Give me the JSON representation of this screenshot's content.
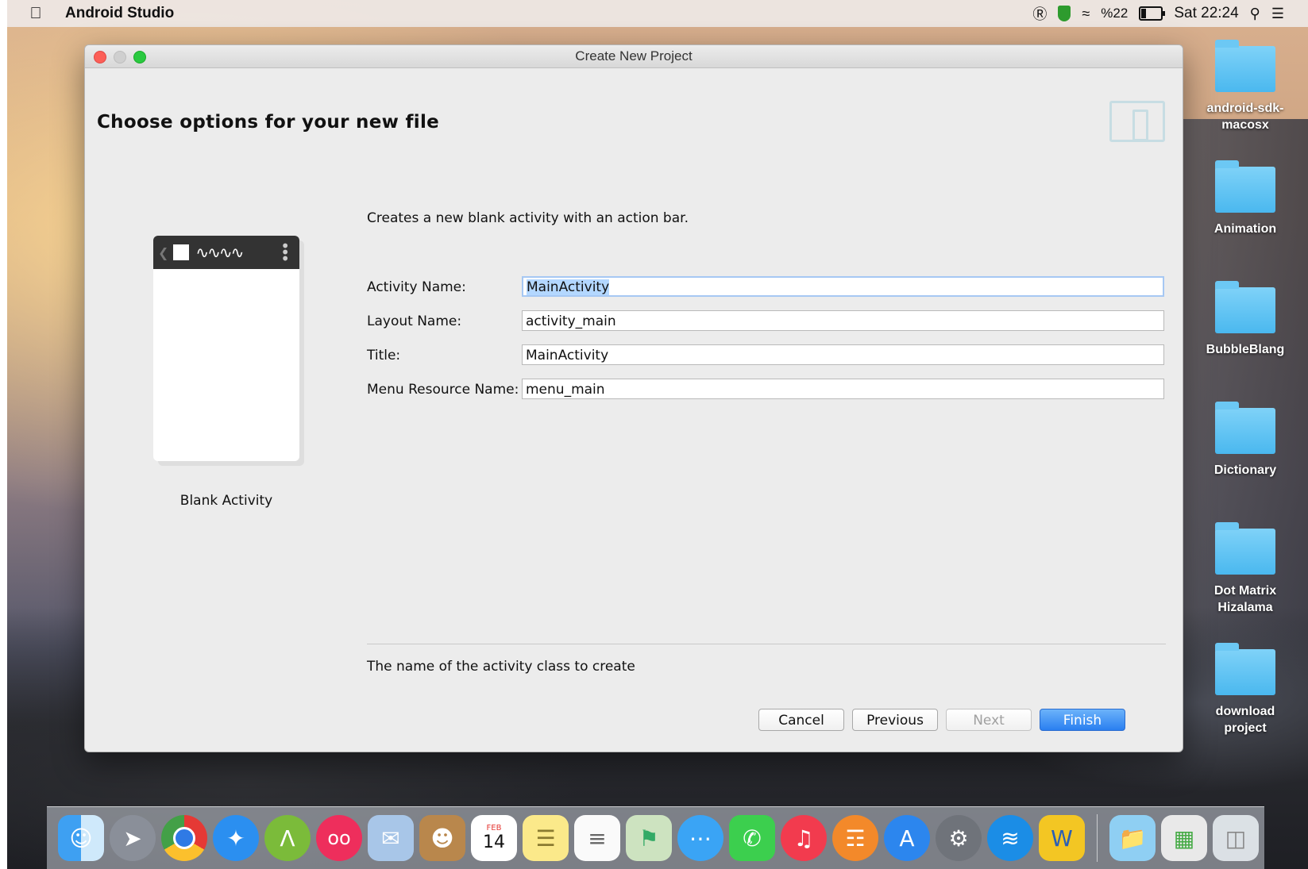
{
  "menubar": {
    "app_name": "Android Studio",
    "battery_percent": "%22",
    "clock": "Sat 22:24",
    "battery_level": 0.22,
    "icons": [
      "apple-icon",
      "d-status-icon",
      "shield-icon",
      "wifi-icon",
      "battery-icon",
      "spotlight-search-icon",
      "notification-list-icon"
    ]
  },
  "window": {
    "title": "Create New Project",
    "heading": "Choose options for your new file"
  },
  "template": {
    "caption": "Blank Activity",
    "description": "Creates a new blank activity with an action bar."
  },
  "form": {
    "activity_name_label": "Activity Name:",
    "activity_name_value": "MainActivity",
    "layout_name_label": "Layout Name:",
    "layout_name_value": "activity_main",
    "title_label": "Title:",
    "title_value": "MainActivity",
    "menu_resource_label": "Menu Resource Name:",
    "menu_resource_value": "menu_main"
  },
  "help_text": "The name of the activity class to create",
  "buttons": {
    "cancel": "Cancel",
    "previous": "Previous",
    "next": "Next",
    "finish": "Finish"
  },
  "colors": {
    "finish_button": "#2a7ff0",
    "selection": "#b3d7ff",
    "folder": "#4ab8ef"
  },
  "desktop_icons": [
    {
      "label": "android-sdk-macosx"
    },
    {
      "label": "Animation"
    },
    {
      "label": "BubbleBlang"
    },
    {
      "label": "Dictionary"
    },
    {
      "label": "Dot Matrix Hizalama"
    },
    {
      "label": "download project"
    }
  ],
  "dock_items": [
    "finder-icon",
    "launchpad-icon",
    "chrome-icon",
    "safari-icon",
    "android-studio-icon",
    "flickr-icon",
    "mail-icon",
    "contacts-icon",
    "calendar-icon",
    "notes-icon",
    "reminders-icon",
    "maps-icon",
    "messages-icon",
    "facetime-icon",
    "itunes-icon",
    "ibooks-icon",
    "app-store-icon",
    "system-preferences-icon",
    "skype-icon",
    "webcode-icon",
    "downloads-folder-icon",
    "documents-stack-icon",
    "trash-icon"
  ],
  "dock": {
    "calendar_month": "FEB",
    "calendar_day": "14"
  }
}
